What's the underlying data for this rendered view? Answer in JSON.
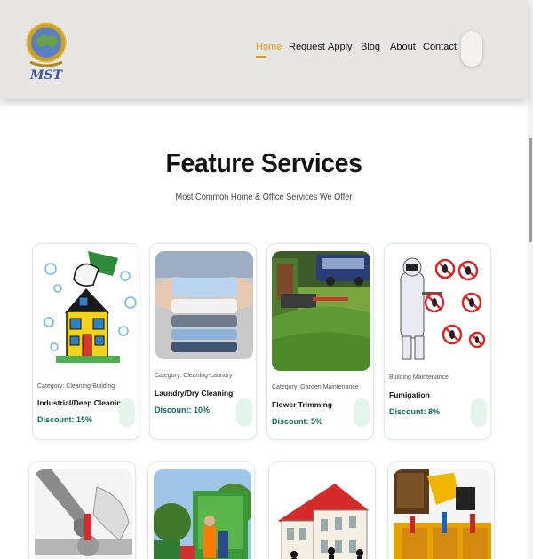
{
  "header": {
    "logo_text": "MST",
    "nav": [
      {
        "label": "Home",
        "active": true
      },
      {
        "label": "Request"
      },
      {
        "label": "Apply"
      },
      {
        "label": "Blog"
      },
      {
        "label": "About"
      },
      {
        "label": "Contact"
      }
    ]
  },
  "section": {
    "title": "Feature Services",
    "subtitle": "Most Common Home & Office Services We Offer"
  },
  "services": [
    {
      "category": "Category: Cleaning-Building",
      "name": "Industrial/Deep Cleaning",
      "discount": "Discount: 15%",
      "image": "house-cleaning-illustration"
    },
    {
      "category": "Category: Cleaning-Laundry",
      "name": "Laundry/Dry Cleaning",
      "discount": "Discount: 10%",
      "image": "folded-laundry-photo"
    },
    {
      "category": "Category: Garden Maintenance",
      "name": "Flower Trimming",
      "discount": "Discount: 5%",
      "image": "hedge-trimming-photo"
    },
    {
      "category": "Building Maintenance",
      "name": "Fumigation",
      "discount": "Discount: 8%",
      "image": "pest-control-illustration"
    }
  ],
  "services_row2": [
    {
      "image": "plumbing-wrench-photo"
    },
    {
      "image": "waste-truck-photo"
    },
    {
      "image": "house-construction-illustration"
    },
    {
      "image": "toolbelt-photo"
    }
  ],
  "colors": {
    "accent": "#e29a17",
    "discount": "#0f6b5a",
    "header_bg": "#e8e6e3"
  }
}
